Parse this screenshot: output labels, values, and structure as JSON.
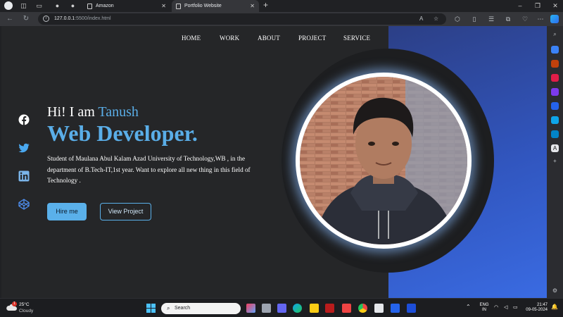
{
  "browser": {
    "tabs": [
      {
        "title": "Amazon",
        "active": false
      },
      {
        "title": "Portfolio Website",
        "active": true
      }
    ],
    "new_tab": "+",
    "url_host": "127.0.0.1",
    "url_rest": ":5500/index.html"
  },
  "site": {
    "nav": [
      "HOME",
      "WORK",
      "ABOUT",
      "PROJECT",
      "SERVICE"
    ],
    "greeting": "Hi! I am ",
    "name": "Tanush",
    "role": "Web Developer.",
    "description": "Student of Maulana Abul Kalam Azad University of Technology,WB , in the department of B.Tech-IT,1st year. Want to explore all new thing in this field of Technology .",
    "hire_button": "Hire me",
    "project_button": "View Project",
    "social": [
      "facebook-icon",
      "twitter-icon",
      "linkedin-icon",
      "codepen-icon"
    ],
    "colors": {
      "accent": "#5aaee8",
      "background": "#252628",
      "panel": "#3156bf"
    }
  },
  "taskbar": {
    "weather_temp": "25°C",
    "weather_cond": "Cloudy",
    "weather_badge": "1",
    "search_label": "Search",
    "lang_1": "ENG",
    "lang_2": "IN",
    "time": "21:47",
    "date": "09-05-2024"
  }
}
